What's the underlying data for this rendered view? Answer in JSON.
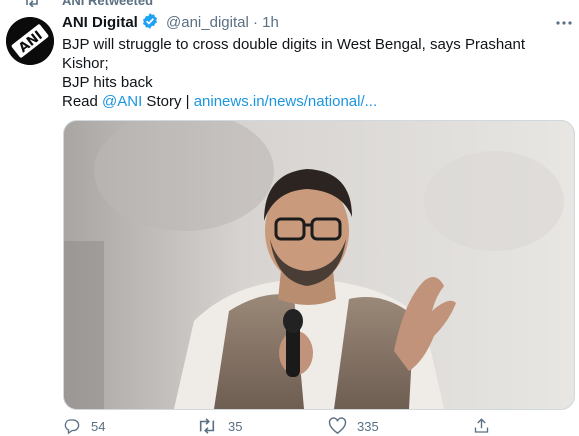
{
  "retweet_banner": {
    "label": "ANI Retweeted"
  },
  "avatar": {
    "text": "ANI"
  },
  "tweet": {
    "author_name": "ANI Digital",
    "handle": "@ani_digital",
    "separator": "·",
    "time": "1h",
    "text_line1": "BJP will struggle to cross double digits in West Bengal, says Prashant Kishor;",
    "text_line2": "BJP hits back",
    "read_prefix": "Read ",
    "mention": "@ANI",
    "story_sep": " Story | ",
    "link_text": "aninews.in/news/national/..."
  },
  "actions": {
    "reply_count": "54",
    "retweet_count": "35",
    "like_count": "335"
  },
  "colors": {
    "link": "#1b95e0",
    "secondary_text": "#5b7083",
    "verified": "#1da1f2"
  }
}
